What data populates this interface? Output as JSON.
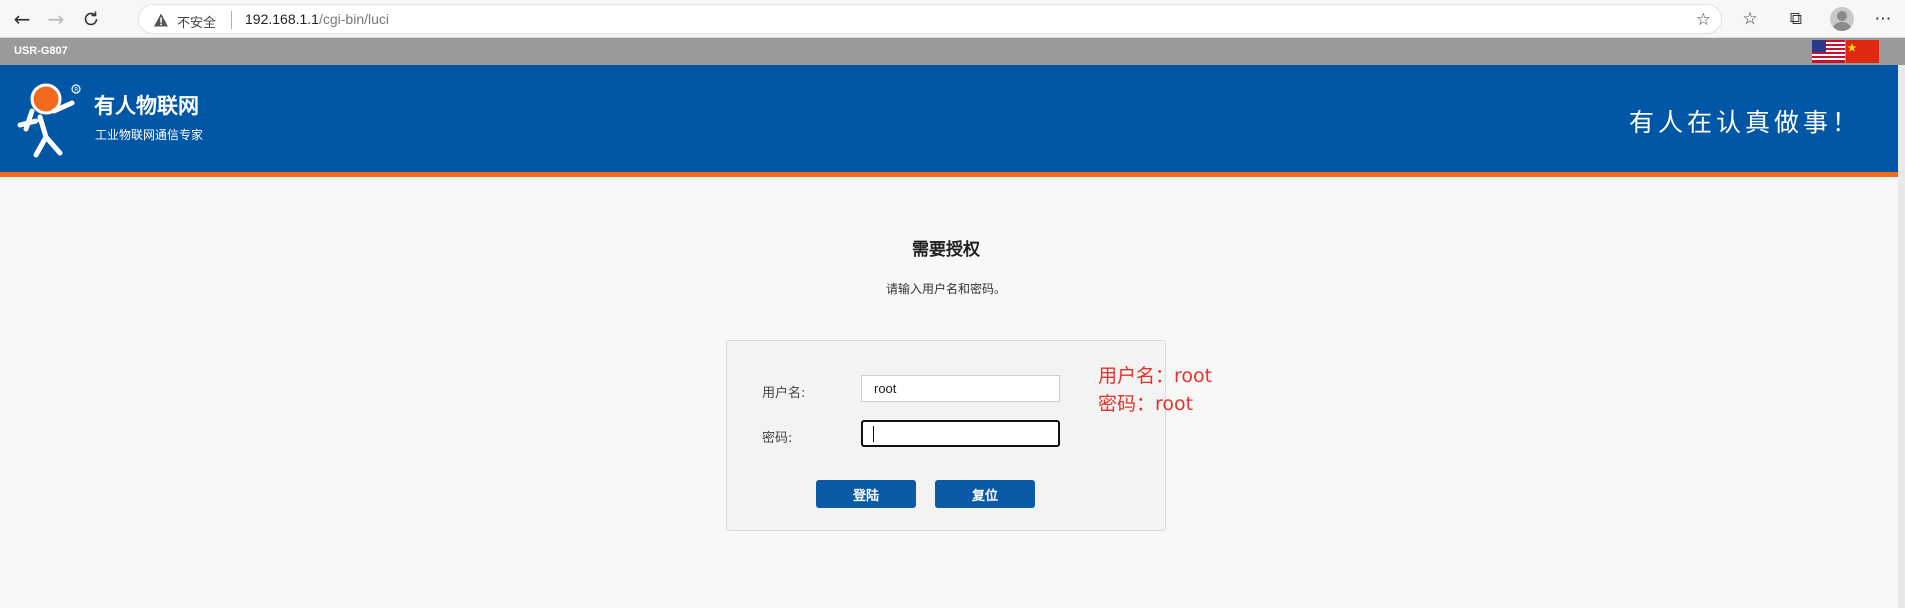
{
  "browser": {
    "insecure_label": "不安全",
    "url_host": "192.168.1.1",
    "url_path": "/cgi-bin/luci"
  },
  "topbar": {
    "model": "USR-G807",
    "languages": [
      "English",
      "中文"
    ]
  },
  "header": {
    "brand_name": "有人物联网",
    "brand_tagline": "工业物联网通信专家",
    "slogan": "有人在认真做事！"
  },
  "login": {
    "title": "需要授权",
    "instruction": "请输入用户名和密码。",
    "username_label": "用户名:",
    "username_value": "root",
    "password_label": "密码:",
    "password_value": "",
    "login_button": "登陆",
    "reset_button": "复位"
  },
  "annotation": {
    "line1": "用户名：root",
    "line2": "密码：root",
    "color": "#e8312a"
  },
  "colors": {
    "header_blue": "#0156a5",
    "accent_orange": "#f26b1d",
    "button_blue": "#0a5aa8"
  }
}
